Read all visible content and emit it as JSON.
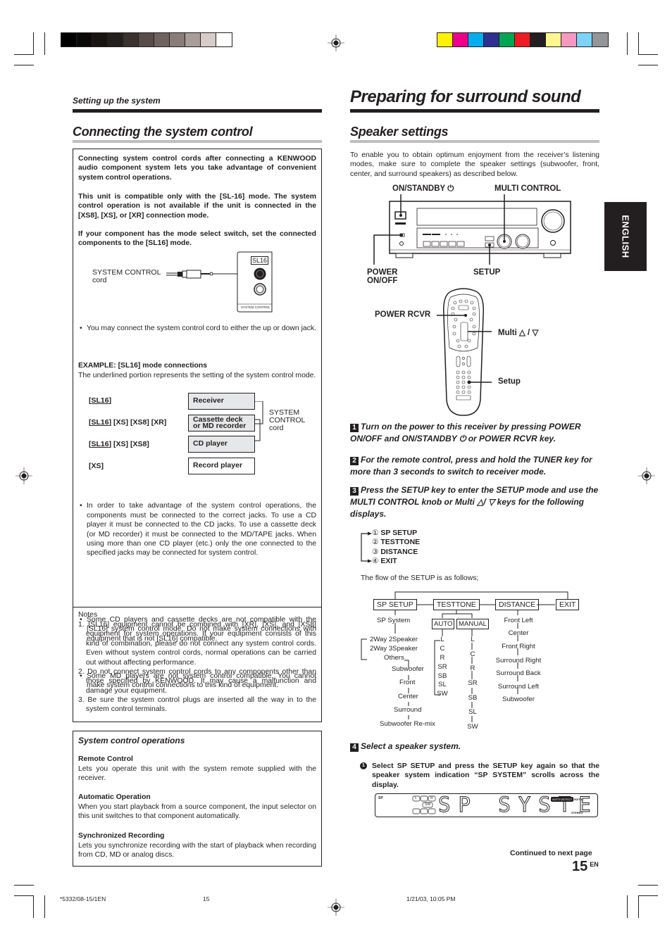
{
  "print_marks": {
    "gray_swatches": [
      "#000000",
      "#0b0908",
      "#181412",
      "#231f1e",
      "#3b3230",
      "#574c49",
      "#6f6360",
      "#8a7d79",
      "#a99e9a",
      "#d6ccc9",
      "#ffffff"
    ],
    "color_swatches": [
      "#fff200",
      "#ec008c",
      "#00aeef",
      "#2e3192",
      "#00a651",
      "#ed1c24",
      "#231f20",
      "#fff68f",
      "#f49ac1",
      "#7dd3f7",
      "#939598"
    ]
  },
  "left": {
    "section_label": "Setting up the system",
    "title": "Connecting the system control",
    "intro": [
      "Connecting system control cords after connecting a KENWOOD audio component system lets you take advantage of convenient system control operations.",
      "This unit is compatible only with the [SL-16] mode. The system control operation is not available if the unit is connected in the [XS8], [XS], or [XR] connection mode.",
      "If your component has the mode select switch, set the connected components to the [SL16] mode."
    ],
    "jack_diagram": {
      "cord_label_1": "SYSTEM CONTROL",
      "cord_label_2": "cord",
      "jack_label": "SL16",
      "panel_label": "SYSTEM CONTROL"
    },
    "jack_note": "You may connect the system control cord to either the up or down jack.",
    "example_title": "EXAMPLE: [SL16] mode connections",
    "example_desc": "The underlined portion represents the setting of the system control mode.",
    "example_rows": [
      {
        "mode_underlined": "SL16",
        "mode_rest": "",
        "component": "Receiver"
      },
      {
        "mode_underlined": "SL16",
        "mode_rest": " [XS] [XS8] [XR]",
        "component_1": "Cassette deck",
        "component_2": "or MD recorder"
      },
      {
        "mode_underlined": "SL16",
        "mode_rest": " [XS] [XS8]",
        "component": "CD player"
      },
      {
        "mode_plain": "[XS]",
        "component": "Record player"
      }
    ],
    "cord_side_label": [
      "SYSTEM",
      "CONTROL",
      "cord"
    ],
    "bullets": [
      "In order to take advantage of the system control operations, the components must be connected to the correct jacks. To use a CD player it must be connected to the CD jacks. To use a cassette deck (or MD recorder) it must be connected to the MD/TAPE jacks. When using more than one CD player (etc.) only the one connected to the specified jacks may be connected for system control.",
      "Some CD players and cassette decks are not compatible with the [SL16] system control mode. Do not make system connections with equipment that is not [SL16] compatible.",
      "Some MD players are not system control compatible. You cannot make system control connections to this kind of equipment."
    ],
    "notes_title": "Notes",
    "notes": [
      "1. [SL16] equipment cannot be combined with [XR], [XS], and [XS8] equipment for system operations. If your equipment consists of this kind of combination, please do not connect any system control cords. Even without system control cords, normal operations can be carried out without affecting performance.",
      "2. Do not connect system control cords to any components other than those specified by KENWOOD. It may cause a malfunction and damage your equipment.",
      "3. Be sure the system control plugs are inserted all the way in to the system control terminals."
    ],
    "operations": {
      "title": "System control operations",
      "items": [
        {
          "heading": "Remote Control",
          "text": "Lets you operate this unit with the system remote supplied with the receiver."
        },
        {
          "heading": "Automatic Operation",
          "text": "When you start playback from a source component, the input selector on this unit switches to that component automatically."
        },
        {
          "heading": "Synchronized Recording",
          "text": "Lets you synchronize recording with the start of playback when recording from CD, MD or analog discs."
        }
      ]
    }
  },
  "right": {
    "title": "Preparing for surround sound",
    "subtitle": "Speaker settings",
    "intro": "To enable you to obtain optimum enjoyment from the receiver’s listening modes, make sure to complete the speaker settings (subwoofer, front, center, and surround speakers) as described below.",
    "receiver_labels": {
      "on_standby": "ON/STANDBY",
      "multi_control": "MULTI CONTROL",
      "power_1": "POWER",
      "power_2": "ON/OFF",
      "setup": "SETUP"
    },
    "remote_labels": {
      "power_rcvr": "POWER RCVR",
      "multi": "Multi △ / ▽",
      "setup": "Setup"
    },
    "steps": [
      {
        "num": "1",
        "text": "Turn on the power to this receiver by pressing POWER ON/OFF and ON/STANDBY ⏻ or POWER RCVR  key."
      },
      {
        "num": "2",
        "text": "For the remote control, press and hold the TUNER key for more than 3 seconds to switch to receiver mode."
      },
      {
        "num": "3",
        "text": "Press the SETUP key to enter the SETUP mode and use the MULTI CONTROL knob or Multi △/ ▽ keys for the following displays."
      }
    ],
    "setup_list": [
      {
        "num": "①",
        "label": "SP SETUP"
      },
      {
        "num": "②",
        "label": "TESTTONE"
      },
      {
        "num": "③",
        "label": "DISTANCE"
      },
      {
        "num": "④",
        "label": "EXIT"
      }
    ],
    "flow_intro": "The flow of the SETUP is as follows;",
    "flow": {
      "main": [
        "SP SETUP",
        "TESTTONE",
        "DISTANCE",
        "EXIT"
      ],
      "sp_setup": [
        "SP System",
        "2Way 2Speaker",
        "2Way 3Speaker",
        "Others",
        "Subwoofer",
        "Front",
        "Center",
        "Surround",
        "Subwoofer Re-mix"
      ],
      "testtone_modes": [
        "AUTO",
        "MANUAL"
      ],
      "auto_channels": [
        "L",
        "C",
        "R",
        "SR",
        "SB",
        "SL",
        "SW"
      ],
      "manual_channels": [
        "L",
        "C",
        "R",
        "SR",
        "SB",
        "SL",
        "SW"
      ],
      "distance": [
        "Front Left",
        "Center",
        "Front Right",
        "Surround Right",
        "Surround Back",
        "Surround Left",
        "Subwoofer"
      ]
    },
    "step4": {
      "num": "4",
      "text": "Select a speaker system."
    },
    "substep": {
      "num": "1",
      "text": "Select SP SETUP and press the SETUP key again so that the speaker system indication “SP SYSTEM” scrolls across the display."
    },
    "display": {
      "text": "SP SYSTE",
      "left_indicator": "SP",
      "speaker_L": "L",
      "speaker_R": "R",
      "speaker_SW": "SW",
      "right_tag": "AUTO DETECT",
      "digital": "DIGITAL",
      "stereo": "STEREO"
    },
    "continued": "Continued to next page",
    "page_number": "15",
    "page_lang": "EN",
    "language_tab": "ENGLISH"
  },
  "footer": {
    "code": "*5332/08-15/1EN",
    "page": "15",
    "timestamp": "1/21/03, 10:05 PM"
  }
}
